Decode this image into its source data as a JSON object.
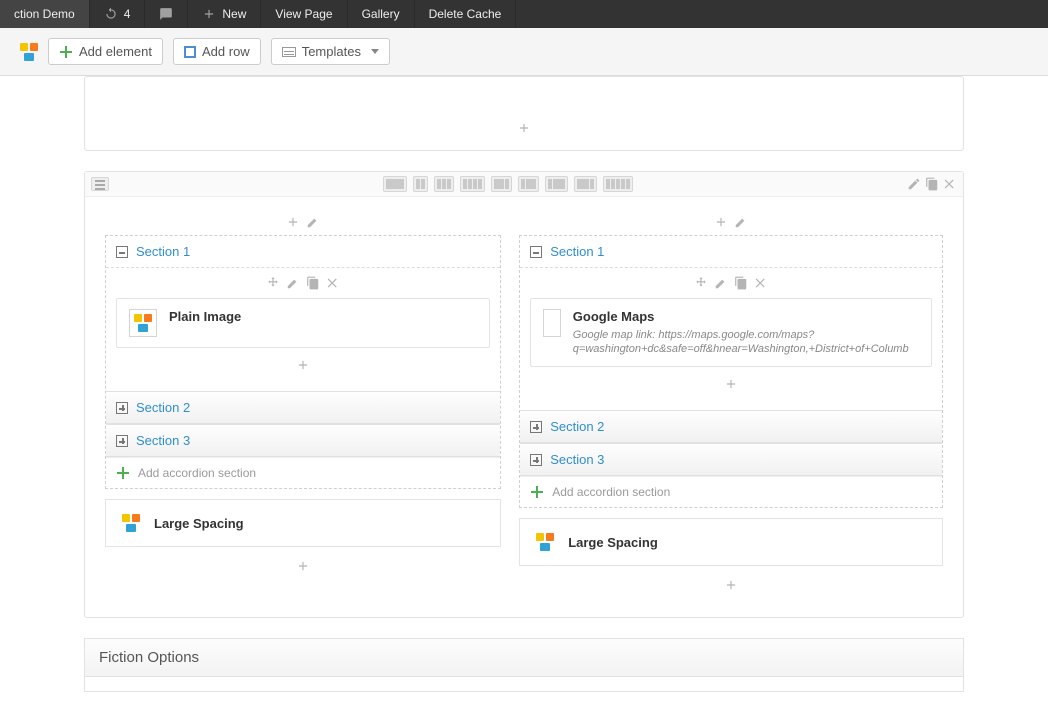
{
  "adminbar": {
    "site_label": "ction Demo",
    "updates_count": "4",
    "new_label": "New",
    "view_label": "View Page",
    "gallery_label": "Gallery",
    "delete_cache_label": "Delete Cache"
  },
  "toolbar": {
    "add_element": "Add element",
    "add_row": "Add row",
    "templates": "Templates"
  },
  "columns": [
    {
      "accordion": {
        "sections": [
          {
            "title": "Section 1",
            "expanded": true,
            "element": {
              "title": "Plain Image",
              "meta_label": "",
              "meta_value": "",
              "thumb": "logo"
            }
          },
          {
            "title": "Section 2",
            "expanded": false
          },
          {
            "title": "Section 3",
            "expanded": false
          }
        ],
        "add_label": "Add accordion section"
      },
      "spacer_label": "Large Spacing"
    },
    {
      "accordion": {
        "sections": [
          {
            "title": "Section 1",
            "expanded": true,
            "element": {
              "title": "Google Maps",
              "meta_label": "Google map link:",
              "meta_value": "https://maps.google.com/maps?q=washington+dc&safe=off&hnear=Washington,+District+of+Columb",
              "thumb": "map"
            }
          },
          {
            "title": "Section 2",
            "expanded": false
          },
          {
            "title": "Section 3",
            "expanded": false
          }
        ],
        "add_label": "Add accordion section"
      },
      "spacer_label": "Large Spacing"
    }
  ],
  "footer_panel": {
    "title": "Fiction Options"
  }
}
